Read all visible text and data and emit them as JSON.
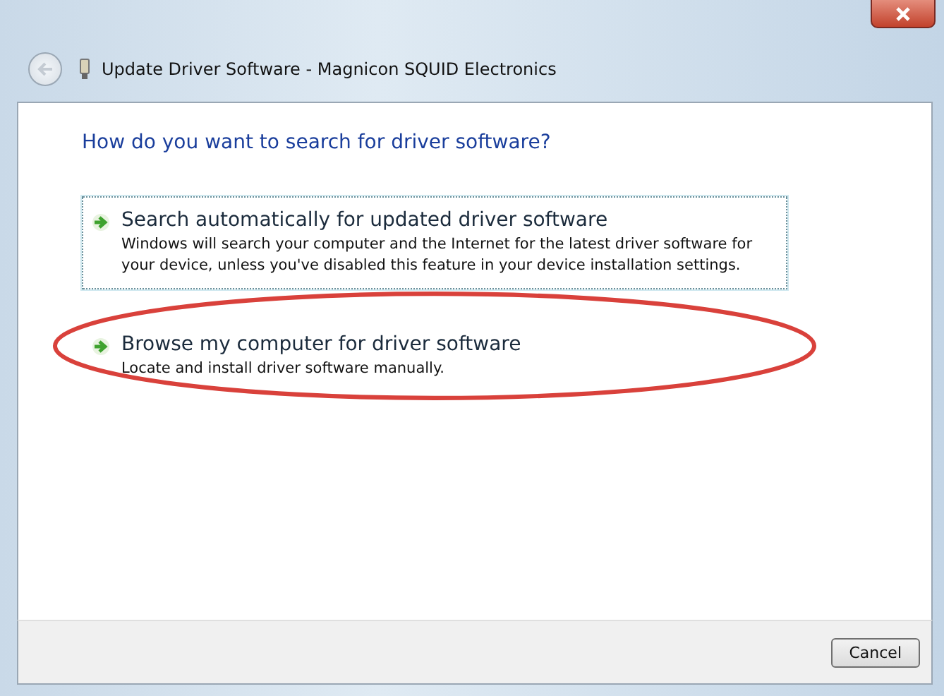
{
  "window": {
    "title": "Update Driver Software - Magnicon SQUID Electronics"
  },
  "heading": "How do you want to search for driver software?",
  "options": [
    {
      "title": "Search automatically for updated driver software",
      "description": "Windows will search your computer and the Internet for the latest driver software for your device, unless you've disabled this feature in your device installation settings.",
      "focused": true,
      "circled": false
    },
    {
      "title": "Browse my computer for driver software",
      "description": "Locate and install driver software manually.",
      "focused": false,
      "circled": true
    }
  ],
  "buttons": [
    "Cancel"
  ]
}
